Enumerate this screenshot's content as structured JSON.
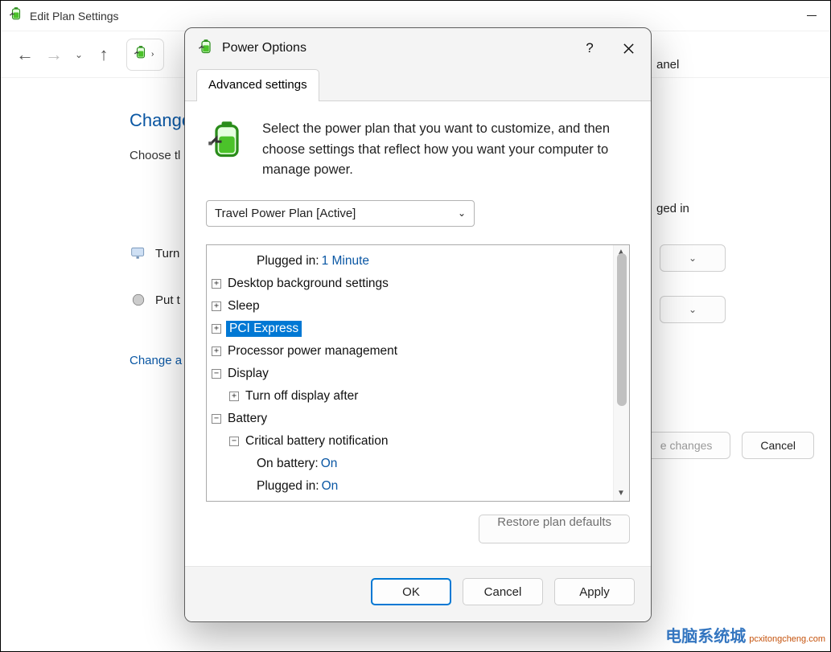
{
  "parent": {
    "title": "Edit Plan Settings",
    "breadcrumb_tail": "anel",
    "heading": "Change",
    "sub": "Choose tl",
    "row1_label": "Turn",
    "row2_label": "Put t",
    "link": "Change a",
    "btn_save": "e changes",
    "btn_cancel": "Cancel",
    "bg_right_text": "ged in"
  },
  "dialog": {
    "title": "Power Options",
    "tab_label": "Advanced settings",
    "intro": "Select the power plan that you want to customize, and then choose settings that reflect how you want your computer to manage power.",
    "plan_selected": "Travel Power Plan [Active]",
    "tree": {
      "pluggedin_1min_key": "Plugged in:",
      "pluggedin_1min_val": "1 Minute",
      "desktop_bg": "Desktop background settings",
      "sleep": "Sleep",
      "pci_express": "PCI Express",
      "proc_pm": "Processor power management",
      "display": "Display",
      "turn_off_display": "Turn off display after",
      "battery": "Battery",
      "crit_batt_notif": "Critical battery notification",
      "on_battery_key": "On battery:",
      "on_battery_val": "On",
      "plugged_in_key": "Plugged in:",
      "plugged_in_val": "On"
    },
    "restore": "Restore plan defaults",
    "ok": "OK",
    "cancel": "Cancel",
    "apply": "Apply"
  },
  "watermark": {
    "cn": "电脑系统城",
    "domain": "pcxitongcheng.com"
  }
}
